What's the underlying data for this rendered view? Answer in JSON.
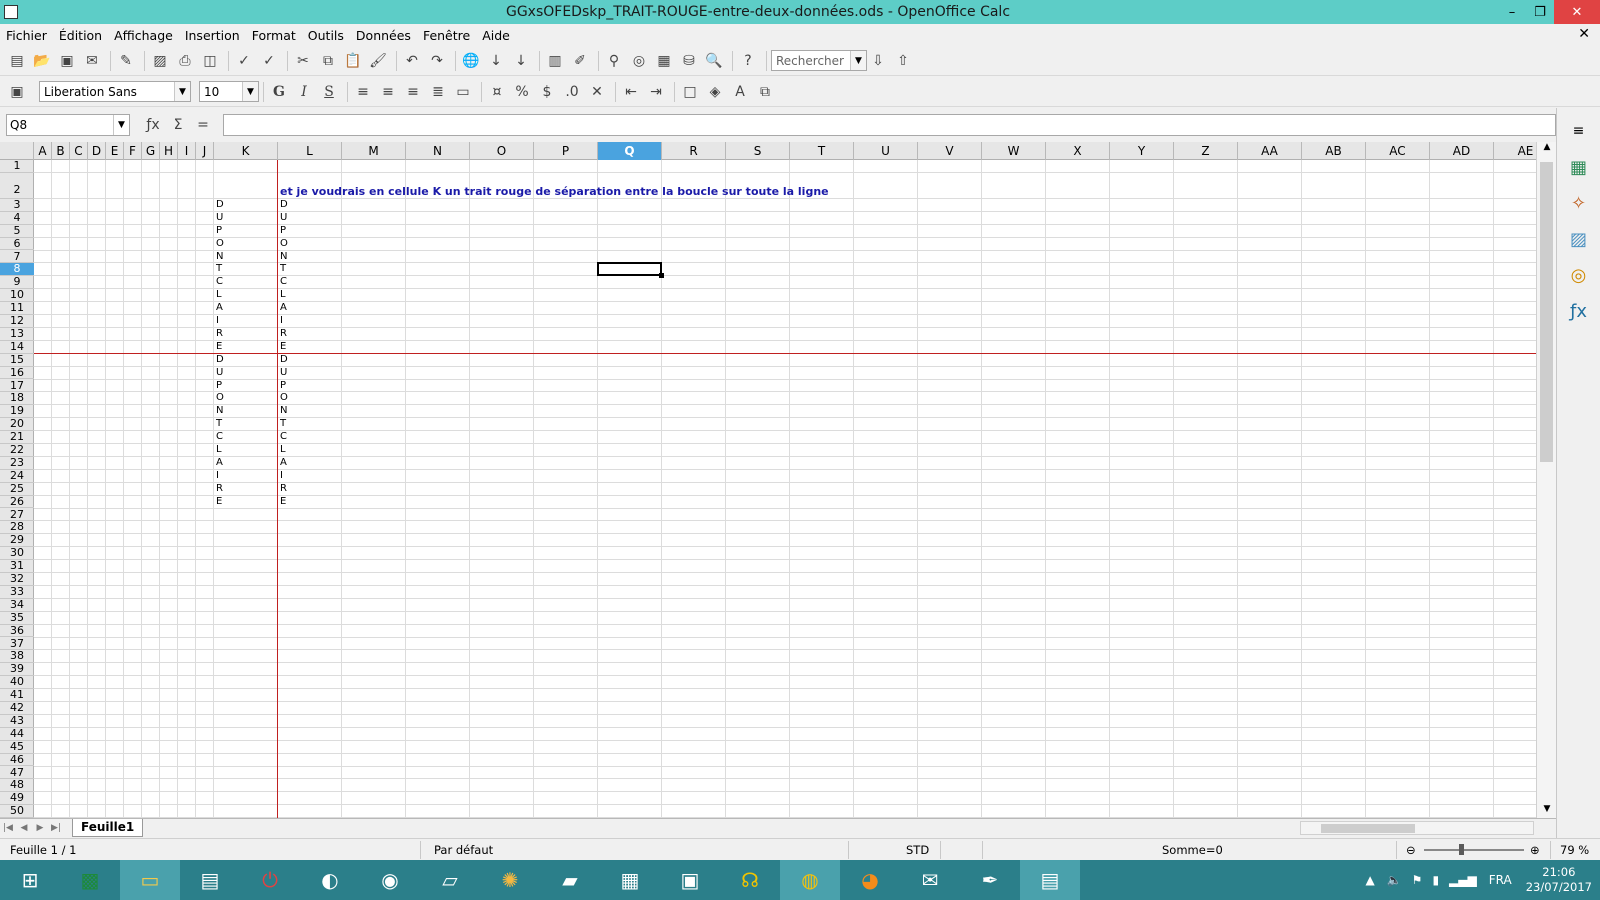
{
  "window": {
    "title": "GGxsOFEDskp_TRAIT-ROUGE-entre-deux-données.ods - OpenOffice Calc",
    "minimize": "–",
    "restore": "❐",
    "close": "✕"
  },
  "menu": [
    "Fichier",
    "Édition",
    "Affichage",
    "Insertion",
    "Format",
    "Outils",
    "Données",
    "Fenêtre",
    "Aide"
  ],
  "menu_close": "✕",
  "toolbar1": {
    "icons": [
      "new-icon",
      "open-icon",
      "save-icon",
      "email-icon",
      "edit-mode-icon",
      "export-pdf-icon",
      "print-icon",
      "print-preview-icon",
      "spellcheck-icon",
      "autospell-icon",
      "cut-icon",
      "copy-icon",
      "paste-icon",
      "format-paintbrush-icon",
      "undo-icon",
      "redo-icon",
      "hyperlink-icon",
      "sort-asc-icon",
      "sort-desc-icon",
      "chart-icon",
      "draw-icon",
      "find-replace-icon",
      "navigator-icon",
      "gallery-icon",
      "datasources-icon",
      "zoom-icon",
      "help-icon"
    ],
    "search_placeholder": "Rechercher"
  },
  "toolbar2": {
    "font_name": "Liberation Sans",
    "font_size": "10",
    "bold": "G",
    "italic": "I",
    "underline": "S",
    "percent": "%"
  },
  "formula_bar": {
    "name_box": "Q8",
    "value": ""
  },
  "columns": [
    {
      "label": "A",
      "w": 18
    },
    {
      "label": "B",
      "w": 18
    },
    {
      "label": "C",
      "w": 18
    },
    {
      "label": "D",
      "w": 18
    },
    {
      "label": "E",
      "w": 18
    },
    {
      "label": "F",
      "w": 18
    },
    {
      "label": "G",
      "w": 18
    },
    {
      "label": "H",
      "w": 18
    },
    {
      "label": "I",
      "w": 18
    },
    {
      "label": "J",
      "w": 18
    },
    {
      "label": "K",
      "w": 64
    },
    {
      "label": "L",
      "w": 64
    },
    {
      "label": "M",
      "w": 64
    },
    {
      "label": "N",
      "w": 64
    },
    {
      "label": "O",
      "w": 64
    },
    {
      "label": "P",
      "w": 64
    },
    {
      "label": "Q",
      "w": 64
    },
    {
      "label": "R",
      "w": 64
    },
    {
      "label": "S",
      "w": 64
    },
    {
      "label": "T",
      "w": 64
    },
    {
      "label": "U",
      "w": 64
    },
    {
      "label": "V",
      "w": 64
    },
    {
      "label": "W",
      "w": 64
    },
    {
      "label": "X",
      "w": 64
    },
    {
      "label": "Y",
      "w": 64
    },
    {
      "label": "Z",
      "w": 64
    },
    {
      "label": "AA",
      "w": 64
    },
    {
      "label": "AB",
      "w": 64
    },
    {
      "label": "AC",
      "w": 64
    },
    {
      "label": "AD",
      "w": 64
    },
    {
      "label": "AE",
      "w": 64
    }
  ],
  "rows": [
    "1",
    "2",
    "3",
    "4",
    "5",
    "6",
    "7",
    "8",
    "9",
    "10",
    "11",
    "12",
    "13",
    "14",
    "15",
    "16",
    "17",
    "18",
    "19",
    "20",
    "21",
    "22",
    "23",
    "24",
    "25",
    "26",
    "27",
    "28",
    "29",
    "30",
    "31",
    "32",
    "33",
    "34",
    "35",
    "36",
    "37",
    "38",
    "39",
    "40",
    "41",
    "42",
    "43",
    "44",
    "45",
    "46",
    "47",
    "48",
    "49",
    "50"
  ],
  "active_cell": {
    "col": "Q",
    "row": "8"
  },
  "note_text": "et je voudrais en cellule K un trait rouge de séparation entre la boucle sur toute la ligne",
  "column_k_values": [
    "D",
    "U",
    "P",
    "O",
    "N",
    "T",
    "C",
    "L",
    "A",
    "I",
    "R",
    "E",
    "D",
    "U",
    "P",
    "O",
    "N",
    "T",
    "C",
    "L",
    "A",
    "I",
    "R",
    "E"
  ],
  "column_l_values": [
    "D",
    "U",
    "P",
    "O",
    "N",
    "T",
    "C",
    "L",
    "A",
    "I",
    "R",
    "E",
    "D",
    "U",
    "P",
    "O",
    "N",
    "T",
    "C",
    "L",
    "A",
    "I",
    "R",
    "E"
  ],
  "sheet_tab": "Feuille1",
  "status": {
    "sheet": "Feuille 1 / 1",
    "style": "Par défaut",
    "mode": "STD",
    "sum": "Somme=0",
    "zoom": "79 %"
  },
  "taskbar": {
    "apps": [
      "start-icon",
      "excel-icon",
      "file-explorer-icon",
      "control-panel-icon",
      "power-icon",
      "bird-app-icon",
      "media-app-icon",
      "folder-app-icon",
      "paint-icon",
      "notebook-icon",
      "calculator-icon",
      "computer-icon",
      "headphones-icon",
      "chrome-icon",
      "firefox-icon",
      "mail-icon",
      "pen-icon",
      "calc-active-icon"
    ],
    "language": "FRA",
    "time": "21:06",
    "date": "23/07/2017"
  }
}
